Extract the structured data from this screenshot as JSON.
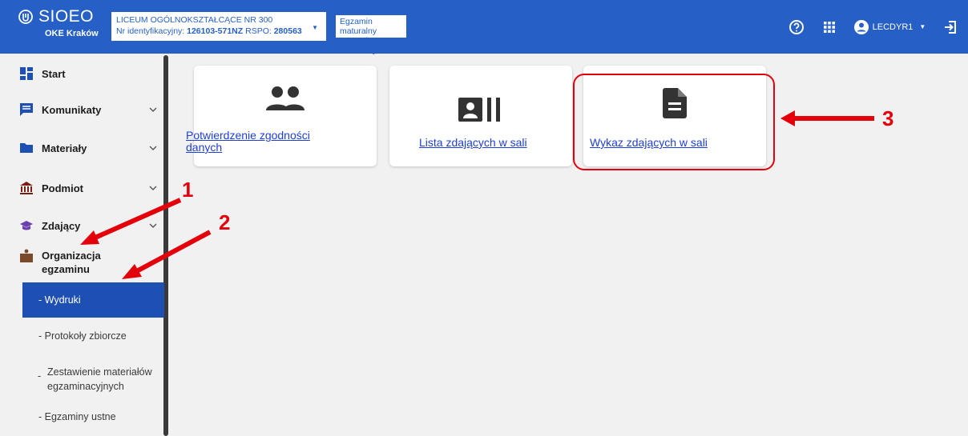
{
  "header": {
    "logo_title": "SIOEO",
    "logo_subtitle": "OKE Kraków",
    "school_name": "LICEUM OGÓLNOKSZTAŁCĄCE NR 300",
    "school_id_prefix": "Nr identyfikacyjny:",
    "school_id": "126103-571NZ",
    "rspo_prefix": "RSPO:",
    "rspo": "280563",
    "exam_line1": "Egzamin maturalny",
    "exam_line2": "Egzamin maturalny",
    "user_name": "LECDYR1",
    "icons": [
      "help-icon",
      "apps-grid-icon",
      "account-icon",
      "logout-icon"
    ]
  },
  "sidebar": {
    "items": [
      {
        "label": "Start",
        "icon": "dashboard-icon"
      },
      {
        "label": "Komunikaty",
        "icon": "message-icon"
      },
      {
        "label": "Materiały",
        "icon": "folder-icon"
      },
      {
        "label": "Podmiot",
        "icon": "institution-icon"
      },
      {
        "label": "Zdający",
        "icon": "graduation-cap-icon"
      },
      {
        "label": "Organizacja egzaminu",
        "icon": "organization-icon"
      }
    ],
    "subitems": [
      "- Wydruki",
      "- Protokoły zbiorcze",
      "Zestawienie materiałów egzaminacyjnych",
      "- Egzaminy ustne"
    ]
  },
  "cards": [
    {
      "label": "Potwierdzenie zgodności danych",
      "icon": "people-icon"
    },
    {
      "label": "Lista zdających w sali",
      "icon": "contact-list-icon"
    },
    {
      "label": "Wykaz zdających w sali",
      "icon": "document-icon"
    }
  ],
  "annotations": {
    "n1": "1",
    "n2": "2",
    "n3": "3",
    "color": "#e3000b"
  },
  "colors": {
    "header": "#2660c6",
    "active_item": "#1e50b3",
    "link": "#1f3fd6"
  }
}
